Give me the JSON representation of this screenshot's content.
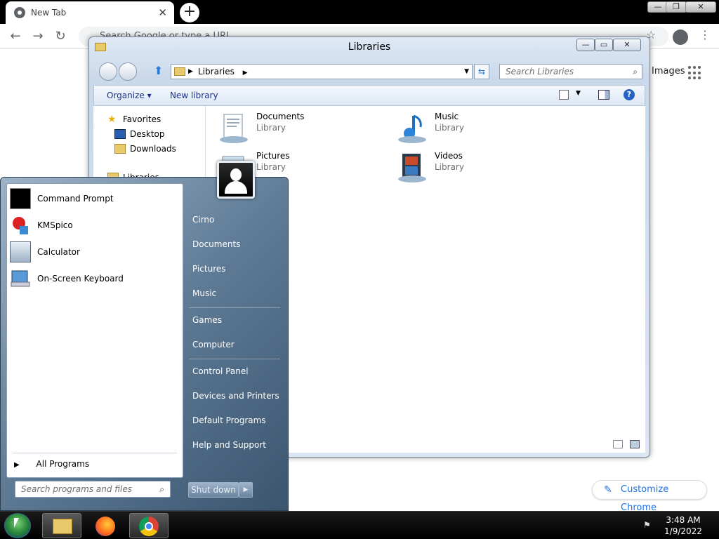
{
  "chrome": {
    "tab_title": "New Tab",
    "tab_close": "✕",
    "new_tab": "+",
    "omnibox_placeholder": "Search Google or type a URL",
    "images_link": "Images",
    "customize_label": "Customize Chrome",
    "window_controls": {
      "minimize": "—",
      "maximize": "❐",
      "close": "✕"
    }
  },
  "explorer": {
    "title": "Libraries",
    "breadcrumb": "Libraries",
    "search_placeholder": "Search Libraries",
    "toolbar": {
      "organize": "Organize ▾",
      "new_library": "New library",
      "help": "?"
    },
    "window_controls": {
      "minimize": "—",
      "maximize": "▭",
      "close": "✕"
    },
    "nav": {
      "favorites": "Favorites",
      "desktop": "Desktop",
      "downloads": "Downloads",
      "libraries": "Libraries"
    },
    "libraries": [
      {
        "name": "Documents",
        "type": "Library"
      },
      {
        "name": "Music",
        "type": "Library"
      },
      {
        "name": "Pictures",
        "type": "Library"
      },
      {
        "name": "Videos",
        "type": "Library"
      }
    ]
  },
  "startmenu": {
    "programs": [
      {
        "label": "Command Prompt",
        "icon": "cmd-icon"
      },
      {
        "label": "KMSpico",
        "icon": "kmspico-icon"
      },
      {
        "label": "Calculator",
        "icon": "calculator-icon"
      },
      {
        "label": "On-Screen Keyboard",
        "icon": "keyboard-icon"
      }
    ],
    "all_programs": "All Programs",
    "search_placeholder": "Search programs and files",
    "right_links": {
      "user": "Cirno",
      "documents": "Documents",
      "pictures": "Pictures",
      "music": "Music",
      "games": "Games",
      "computer": "Computer",
      "control_panel": "Control Panel",
      "devices_printers": "Devices and Printers",
      "default_programs": "Default Programs",
      "help_support": "Help and Support"
    },
    "shutdown": "Shut down"
  },
  "taskbar": {
    "time": "3:48 AM",
    "date": "1/9/2022"
  },
  "colors": {
    "accent": "#1a73e8",
    "start_menu": "#5e7a95",
    "taskbar": "#000000"
  }
}
